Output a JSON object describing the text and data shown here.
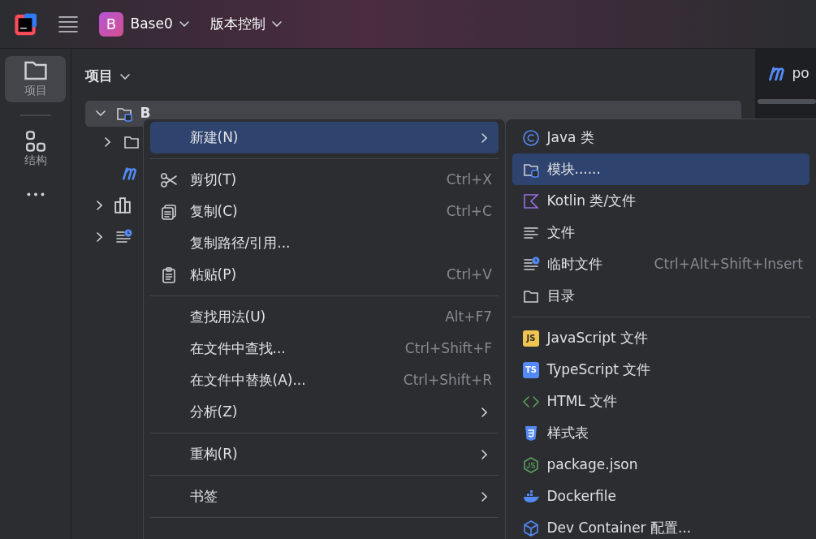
{
  "header": {
    "project_badge": "B",
    "project_name": "Base0",
    "vcs_label": "版本控制"
  },
  "tool_strip": [
    {
      "kind": "project",
      "label": "项目",
      "selected": true
    },
    {
      "kind": "structure",
      "label": "结构",
      "selected": false
    },
    {
      "kind": "more",
      "selected": false
    }
  ],
  "project_panel": {
    "title": "项目",
    "tree_root": {
      "label": "B",
      "expanded": true
    }
  },
  "editor": {
    "tab_label": "po"
  },
  "context_menu": [
    {
      "kind": "submenu",
      "label": "新建(N)",
      "selected": true
    },
    {
      "kind": "separator"
    },
    {
      "kind": "cut",
      "label": "剪切(T)",
      "shortcut": "Ctrl+X",
      "selected": false
    },
    {
      "kind": "copy",
      "label": "复制(C)",
      "shortcut": "Ctrl+C",
      "selected": false
    },
    {
      "kind": "item",
      "label": "复制路径/引用...",
      "selected": false
    },
    {
      "kind": "paste",
      "label": "粘贴(P)",
      "shortcut": "Ctrl+V",
      "selected": false
    },
    {
      "kind": "separator"
    },
    {
      "kind": "item",
      "label": "查找用法(U)",
      "shortcut": "Alt+F7",
      "selected": false
    },
    {
      "kind": "item",
      "label": "在文件中查找...",
      "shortcut": "Ctrl+Shift+F",
      "selected": false
    },
    {
      "kind": "item",
      "label": "在文件中替换(A)...",
      "shortcut": "Ctrl+Shift+R",
      "selected": false
    },
    {
      "kind": "submenu",
      "label": "分析(Z)",
      "selected": false
    },
    {
      "kind": "separator"
    },
    {
      "kind": "submenu",
      "label": "重构(R)",
      "selected": false
    },
    {
      "kind": "separator"
    },
    {
      "kind": "submenu",
      "label": "书签",
      "selected": false
    },
    {
      "kind": "separator"
    }
  ],
  "new_submenu": [
    {
      "kind": "java",
      "label": "Java 类",
      "selected": false
    },
    {
      "kind": "module",
      "label": "模块......",
      "selected": true
    },
    {
      "kind": "kotlin",
      "label": "Kotlin 类/文件",
      "selected": false
    },
    {
      "kind": "file",
      "label": "文件",
      "selected": false
    },
    {
      "kind": "scratch",
      "label": "临时文件",
      "shortcut": "Ctrl+Alt+Shift+Insert",
      "selected": false
    },
    {
      "kind": "directory",
      "label": "目录",
      "selected": false
    },
    {
      "kind": "separator"
    },
    {
      "kind": "javascript",
      "icon_text": "JS",
      "label": "JavaScript 文件",
      "selected": false
    },
    {
      "kind": "typescript",
      "icon_text": "TS",
      "label": "TypeScript 文件",
      "selected": false
    },
    {
      "kind": "html",
      "label": "HTML 文件",
      "selected": false
    },
    {
      "kind": "stylesheet",
      "label": "样式表",
      "selected": false
    },
    {
      "kind": "npm",
      "label": "package.json",
      "selected": false
    },
    {
      "kind": "docker",
      "label": "Dockerfile",
      "selected": false
    },
    {
      "kind": "devcontainer",
      "label": "Dev Container 配置...",
      "selected": false
    }
  ]
}
